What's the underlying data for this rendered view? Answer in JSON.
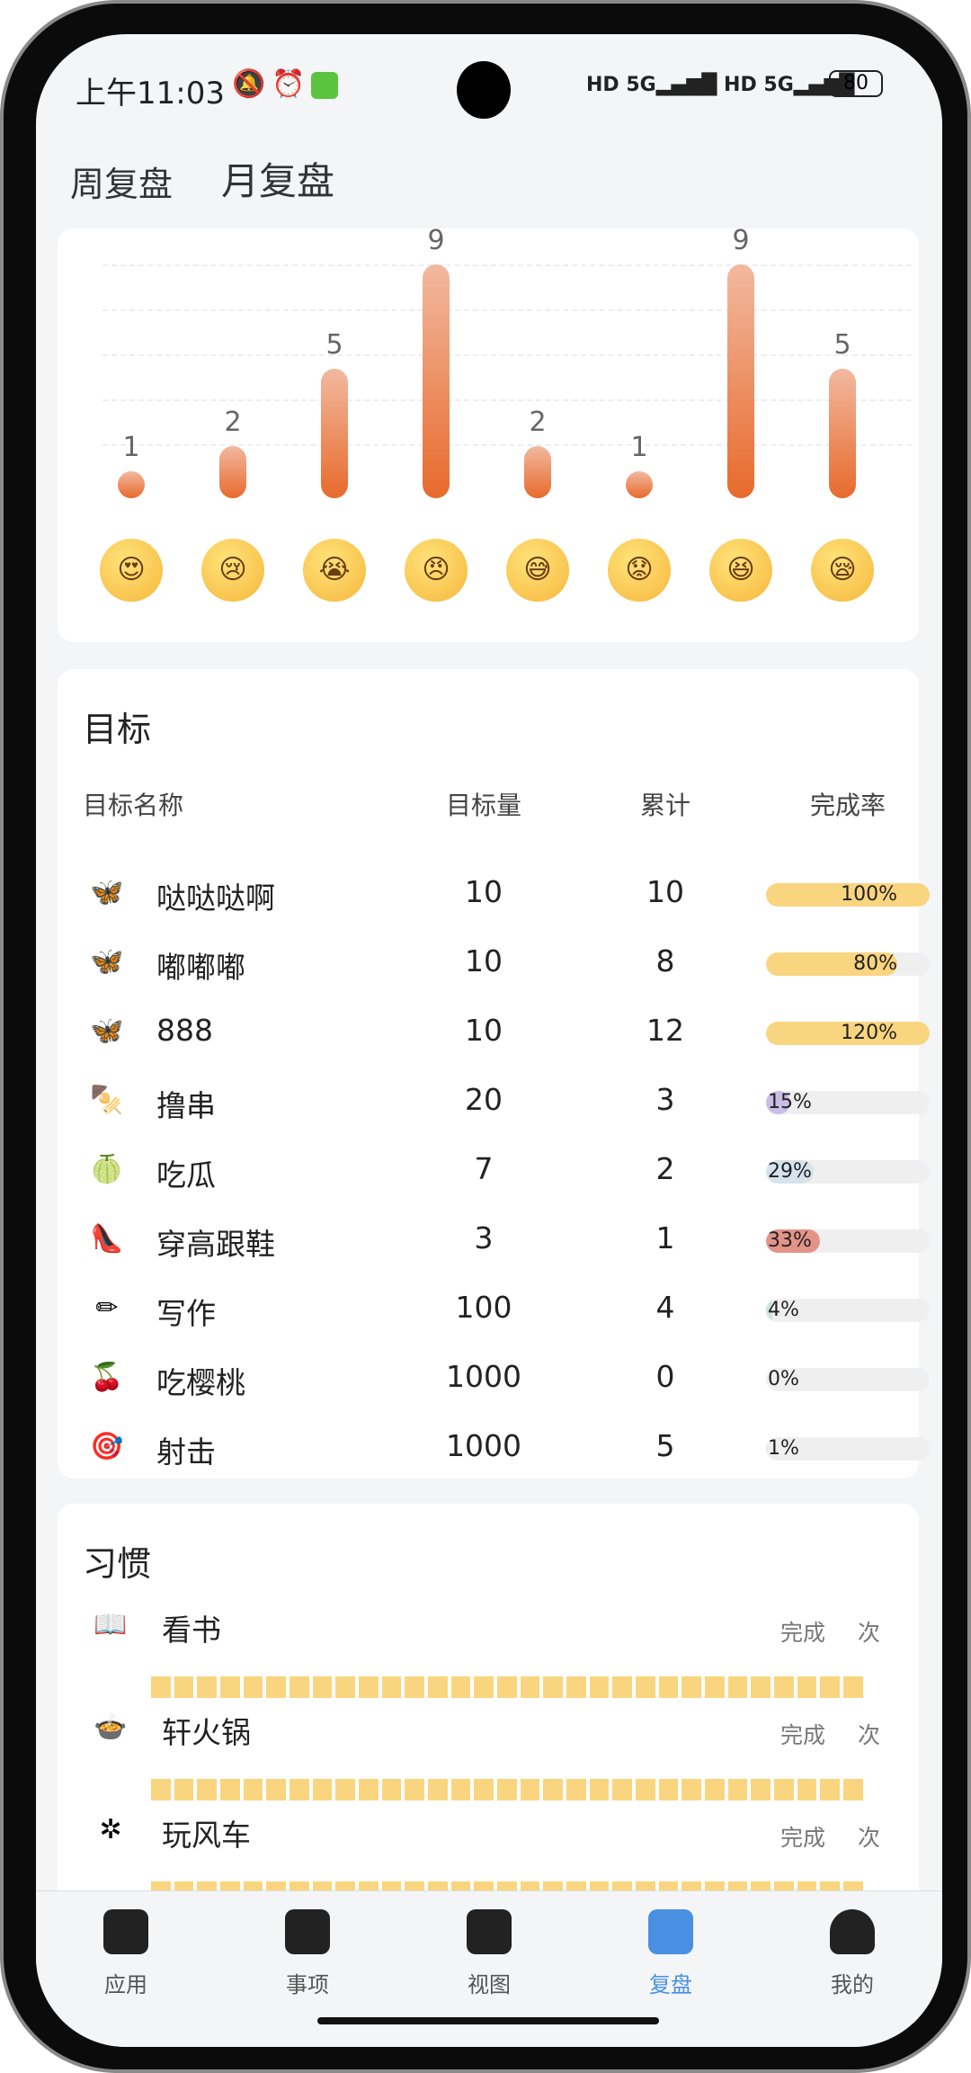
{
  "status_bar": {
    "time": "上午11:03",
    "battery": "80",
    "network": "5G"
  },
  "tabs": [
    {
      "label": "周复盘",
      "active": false
    },
    {
      "label": "月复盘",
      "active": true
    }
  ],
  "chart_data": {
    "type": "bar",
    "categories": [
      "love",
      "sad",
      "cry",
      "angry",
      "sweat",
      "worried",
      "laugh",
      "sleepy"
    ],
    "values": [
      1,
      2,
      5,
      9,
      2,
      1,
      9,
      5
    ],
    "ylim": [
      0,
      9
    ],
    "grid": true,
    "bar_color": "#e86a2c"
  },
  "emotions": [
    {
      "icon": "heart-eyes-face",
      "glyph": "😍"
    },
    {
      "icon": "sad-face",
      "glyph": "😢"
    },
    {
      "icon": "crying-face",
      "glyph": "😭"
    },
    {
      "icon": "angry-face",
      "glyph": "😠"
    },
    {
      "icon": "sweat-smile-face",
      "glyph": "😅"
    },
    {
      "icon": "worried-face",
      "glyph": "😟"
    },
    {
      "icon": "squint-laugh-face",
      "glyph": "😆"
    },
    {
      "icon": "sleepy-face",
      "glyph": "😪"
    }
  ],
  "goals": {
    "title": "目标",
    "headers": [
      "目标名称",
      "目标量",
      "累计",
      "完成率"
    ],
    "rows": [
      {
        "icon": "butterfly",
        "glyph": "🦋",
        "name": "哒哒哒啊",
        "target": "10",
        "total": "10",
        "rate": "100%",
        "pct": 100,
        "color": "#fad57f"
      },
      {
        "icon": "butterfly",
        "glyph": "🦋",
        "name": "嘟嘟嘟",
        "target": "10",
        "total": "8",
        "rate": "80%",
        "pct": 80,
        "color": "#fad57f"
      },
      {
        "icon": "butterfly",
        "glyph": "🦋",
        "name": "888",
        "target": "10",
        "total": "12",
        "rate": "120%",
        "pct": 100,
        "color": "#fad57f"
      },
      {
        "icon": "skewer",
        "glyph": "🍢",
        "name": "撸串",
        "target": "20",
        "total": "3",
        "rate": "15%",
        "pct": 15,
        "color": "#c9bde6"
      },
      {
        "icon": "melon",
        "glyph": "🍈",
        "name": "吃瓜",
        "target": "7",
        "total": "2",
        "rate": "29%",
        "pct": 29,
        "color": "#d6e3ee"
      },
      {
        "icon": "high-heel",
        "glyph": "👠",
        "name": "穿高跟鞋",
        "target": "3",
        "total": "1",
        "rate": "33%",
        "pct": 33,
        "color": "#e39488"
      },
      {
        "icon": "pencil",
        "glyph": "✏",
        "name": "写作",
        "target": "100",
        "total": "4",
        "rate": "4%",
        "pct": 4,
        "color": "#cfe3e0"
      },
      {
        "icon": "cherries",
        "glyph": "🍒",
        "name": "吃樱桃",
        "target": "1000",
        "total": "0",
        "rate": "0%",
        "pct": 0,
        "color": "#efefef"
      },
      {
        "icon": "target",
        "glyph": "🎯",
        "name": "射击",
        "target": "1000",
        "total": "5",
        "rate": "1%",
        "pct": 1,
        "color": "#e8ece0"
      }
    ]
  },
  "habits": {
    "title": "习惯",
    "done_label": "完成",
    "times_label": "次",
    "rows": [
      {
        "icon": "book",
        "glyph": "📖",
        "name": "看书"
      },
      {
        "icon": "hotpot",
        "glyph": "🍲",
        "name": "轩火锅"
      },
      {
        "icon": "pinwheel",
        "glyph": "✲",
        "name": "玩风车"
      }
    ]
  },
  "nav": [
    {
      "label": "应用",
      "icon": "home-icon"
    },
    {
      "label": "事项",
      "icon": "calendar-check-icon"
    },
    {
      "label": "视图",
      "icon": "clover-icon"
    },
    {
      "label": "复盘",
      "icon": "bar-chart-icon",
      "active": true
    },
    {
      "label": "我的",
      "icon": "user-icon"
    }
  ],
  "accent": "#4a90e2"
}
